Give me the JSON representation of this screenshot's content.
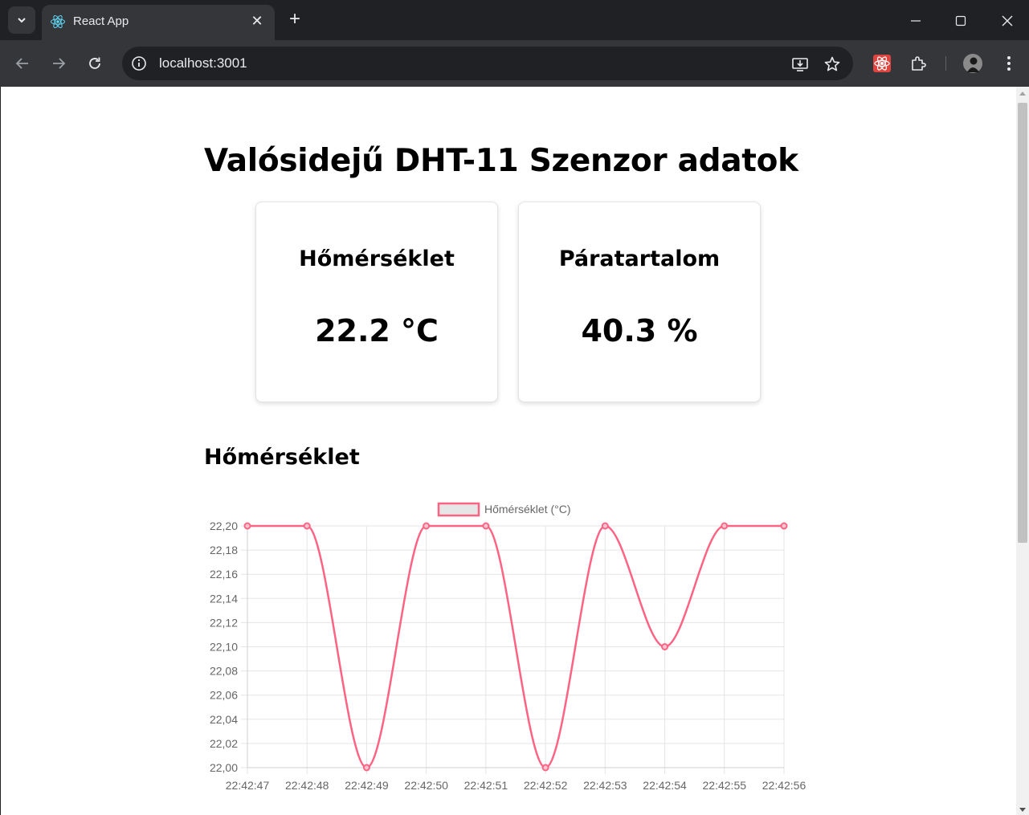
{
  "browser": {
    "tab_title": "React App",
    "url": "localhost:3001"
  },
  "page": {
    "title": "Valósidejű DHT-11 Szenzor adatok",
    "cards": [
      {
        "title": "Hőmérséklet",
        "value": "22.2 °C"
      },
      {
        "title": "Páratartalom",
        "value": "40.3 %"
      }
    ],
    "section_title": "Hőmérséklet"
  },
  "chart_data": {
    "type": "line",
    "x": [
      "22:42:47",
      "22:42:48",
      "22:42:49",
      "22:42:50",
      "22:42:51",
      "22:42:52",
      "22:42:53",
      "22:42:54",
      "22:42:55",
      "22:42:56"
    ],
    "series": [
      {
        "name": "Hőmérséklet (°C)",
        "values": [
          22.2,
          22.2,
          22.0,
          22.2,
          22.2,
          22.0,
          22.2,
          22.1,
          22.2,
          22.2
        ]
      }
    ],
    "ylim": [
      22.0,
      22.2
    ],
    "yticks": [
      "22,20",
      "22,18",
      "22,16",
      "22,14",
      "22,12",
      "22,10",
      "22,08",
      "22,06",
      "22,04",
      "22,02",
      "22,00"
    ],
    "legend": "top-center",
    "grid": true,
    "line_color": "#ff6384",
    "legend_fill": "#e6e6e6"
  }
}
